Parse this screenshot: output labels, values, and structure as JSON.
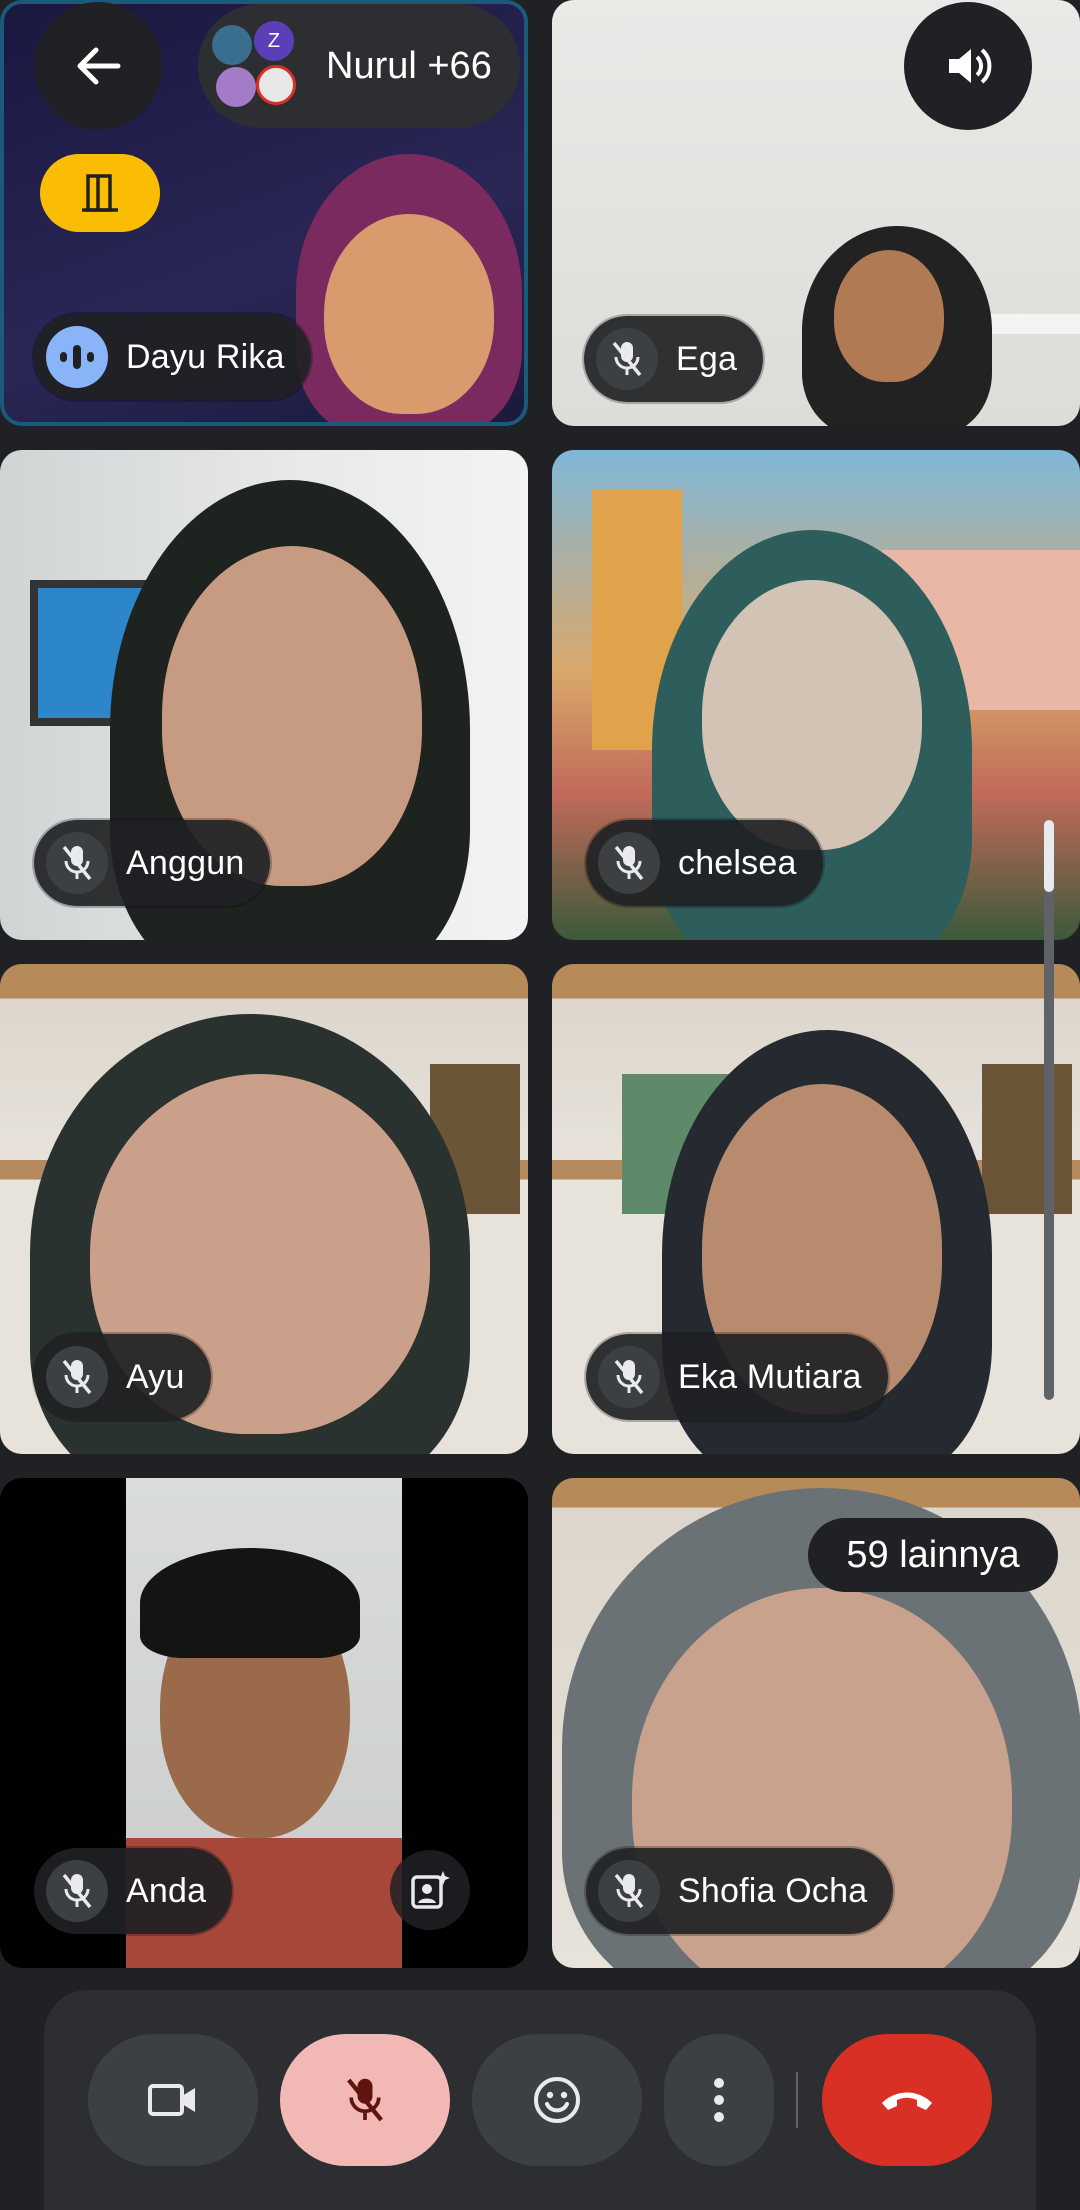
{
  "header": {
    "participants_label": "Nurul +66",
    "avatar_initial": "Z"
  },
  "tiles": [
    {
      "name": "Dayu Rika",
      "mic": "speaking"
    },
    {
      "name": "Ega",
      "mic": "muted"
    },
    {
      "name": "Anggun",
      "mic": "muted"
    },
    {
      "name": "chelsea",
      "mic": "muted"
    },
    {
      "name": "Ayu",
      "mic": "muted"
    },
    {
      "name": "Eka Mutiara",
      "mic": "muted"
    },
    {
      "name": "Anda",
      "mic": "muted"
    },
    {
      "name": "Shofia Ocha",
      "mic": "muted"
    }
  ],
  "more_participants": "59 lainnya",
  "controls": {
    "camera": "video-camera-icon",
    "mic": "mic-off-icon",
    "reactions": "emoji-icon",
    "more": "more-vert-icon",
    "end_call": "call-end-icon"
  },
  "colors": {
    "leave_yellow": "#fbbc04",
    "end_call_red": "#d93025",
    "mic_active_pink": "#f2b8b5",
    "speaking_blue": "#8ab4f8"
  }
}
